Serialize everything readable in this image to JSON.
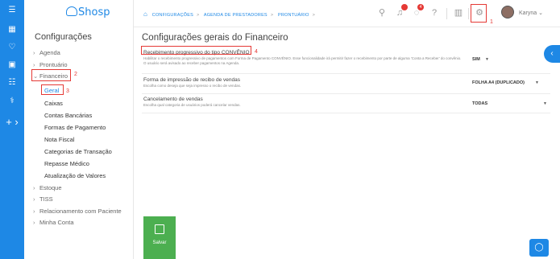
{
  "app": {
    "logo_text": "Shosp"
  },
  "rail": {
    "icons": [
      "menu-icon",
      "calendar-icon",
      "heart-icon",
      "money-icon",
      "list-icon",
      "stethoscope-icon",
      "plus-icon"
    ]
  },
  "sidebar": {
    "title": "Configurações",
    "items": [
      {
        "label": "Agenda"
      },
      {
        "label": "Prontuário"
      },
      {
        "label": "Financeiro"
      },
      {
        "label": "Estoque"
      },
      {
        "label": "TISS"
      },
      {
        "label": "Relacionamento com Paciente"
      },
      {
        "label": "Minha Conta"
      }
    ],
    "financeiro_children": [
      {
        "label": "Geral"
      },
      {
        "label": "Caixas"
      },
      {
        "label": "Contas Bancárias"
      },
      {
        "label": "Formas de Pagamento"
      },
      {
        "label": "Nota Fiscal"
      },
      {
        "label": "Categorias de Transação"
      },
      {
        "label": "Repasse Médico"
      },
      {
        "label": "Atualização de Valores"
      }
    ]
  },
  "header": {
    "breadcrumbs": [
      "CONFIGURAÇÕES",
      "AGENDA DE PRESTADORES",
      "PRONTUÁRIO"
    ],
    "notif_badge": "",
    "chat_badge": "4",
    "username": "Karyna"
  },
  "annotations": {
    "a1": "1",
    "a2": "2",
    "a3": "3",
    "a4": "4"
  },
  "main": {
    "title": "Configurações gerais do Financeiro",
    "settings": [
      {
        "title": "Recebimento progressivo do tipo CONVÊNIO",
        "desc": "Habilitar o recebimento progressivo de pagamentos com Forma de Pagamento CONVÊNIO. Esse funcionalidade irá permitir fazer o recebimento por parte de alguma 'Conta a Receber' do convênio. O usuário será avisado ao receber pagamentos na Agenda.",
        "value": "SIM"
      },
      {
        "title": "Forma de impressão de recibo de vendas",
        "desc": "Escolha como deseja que seja impresso o recibo de vendas.",
        "value": "FOLHA A4 (DUPLICADO)"
      },
      {
        "title": "Cancelamento de vendas",
        "desc": "Escolha qual categoria de usuários poderá cancelar vendas.",
        "value": "TODAS"
      }
    ],
    "save_label": "Salvar"
  },
  "colors": {
    "primary": "#1e88e5",
    "save": "#4caf50",
    "annotation": "#e53935"
  }
}
